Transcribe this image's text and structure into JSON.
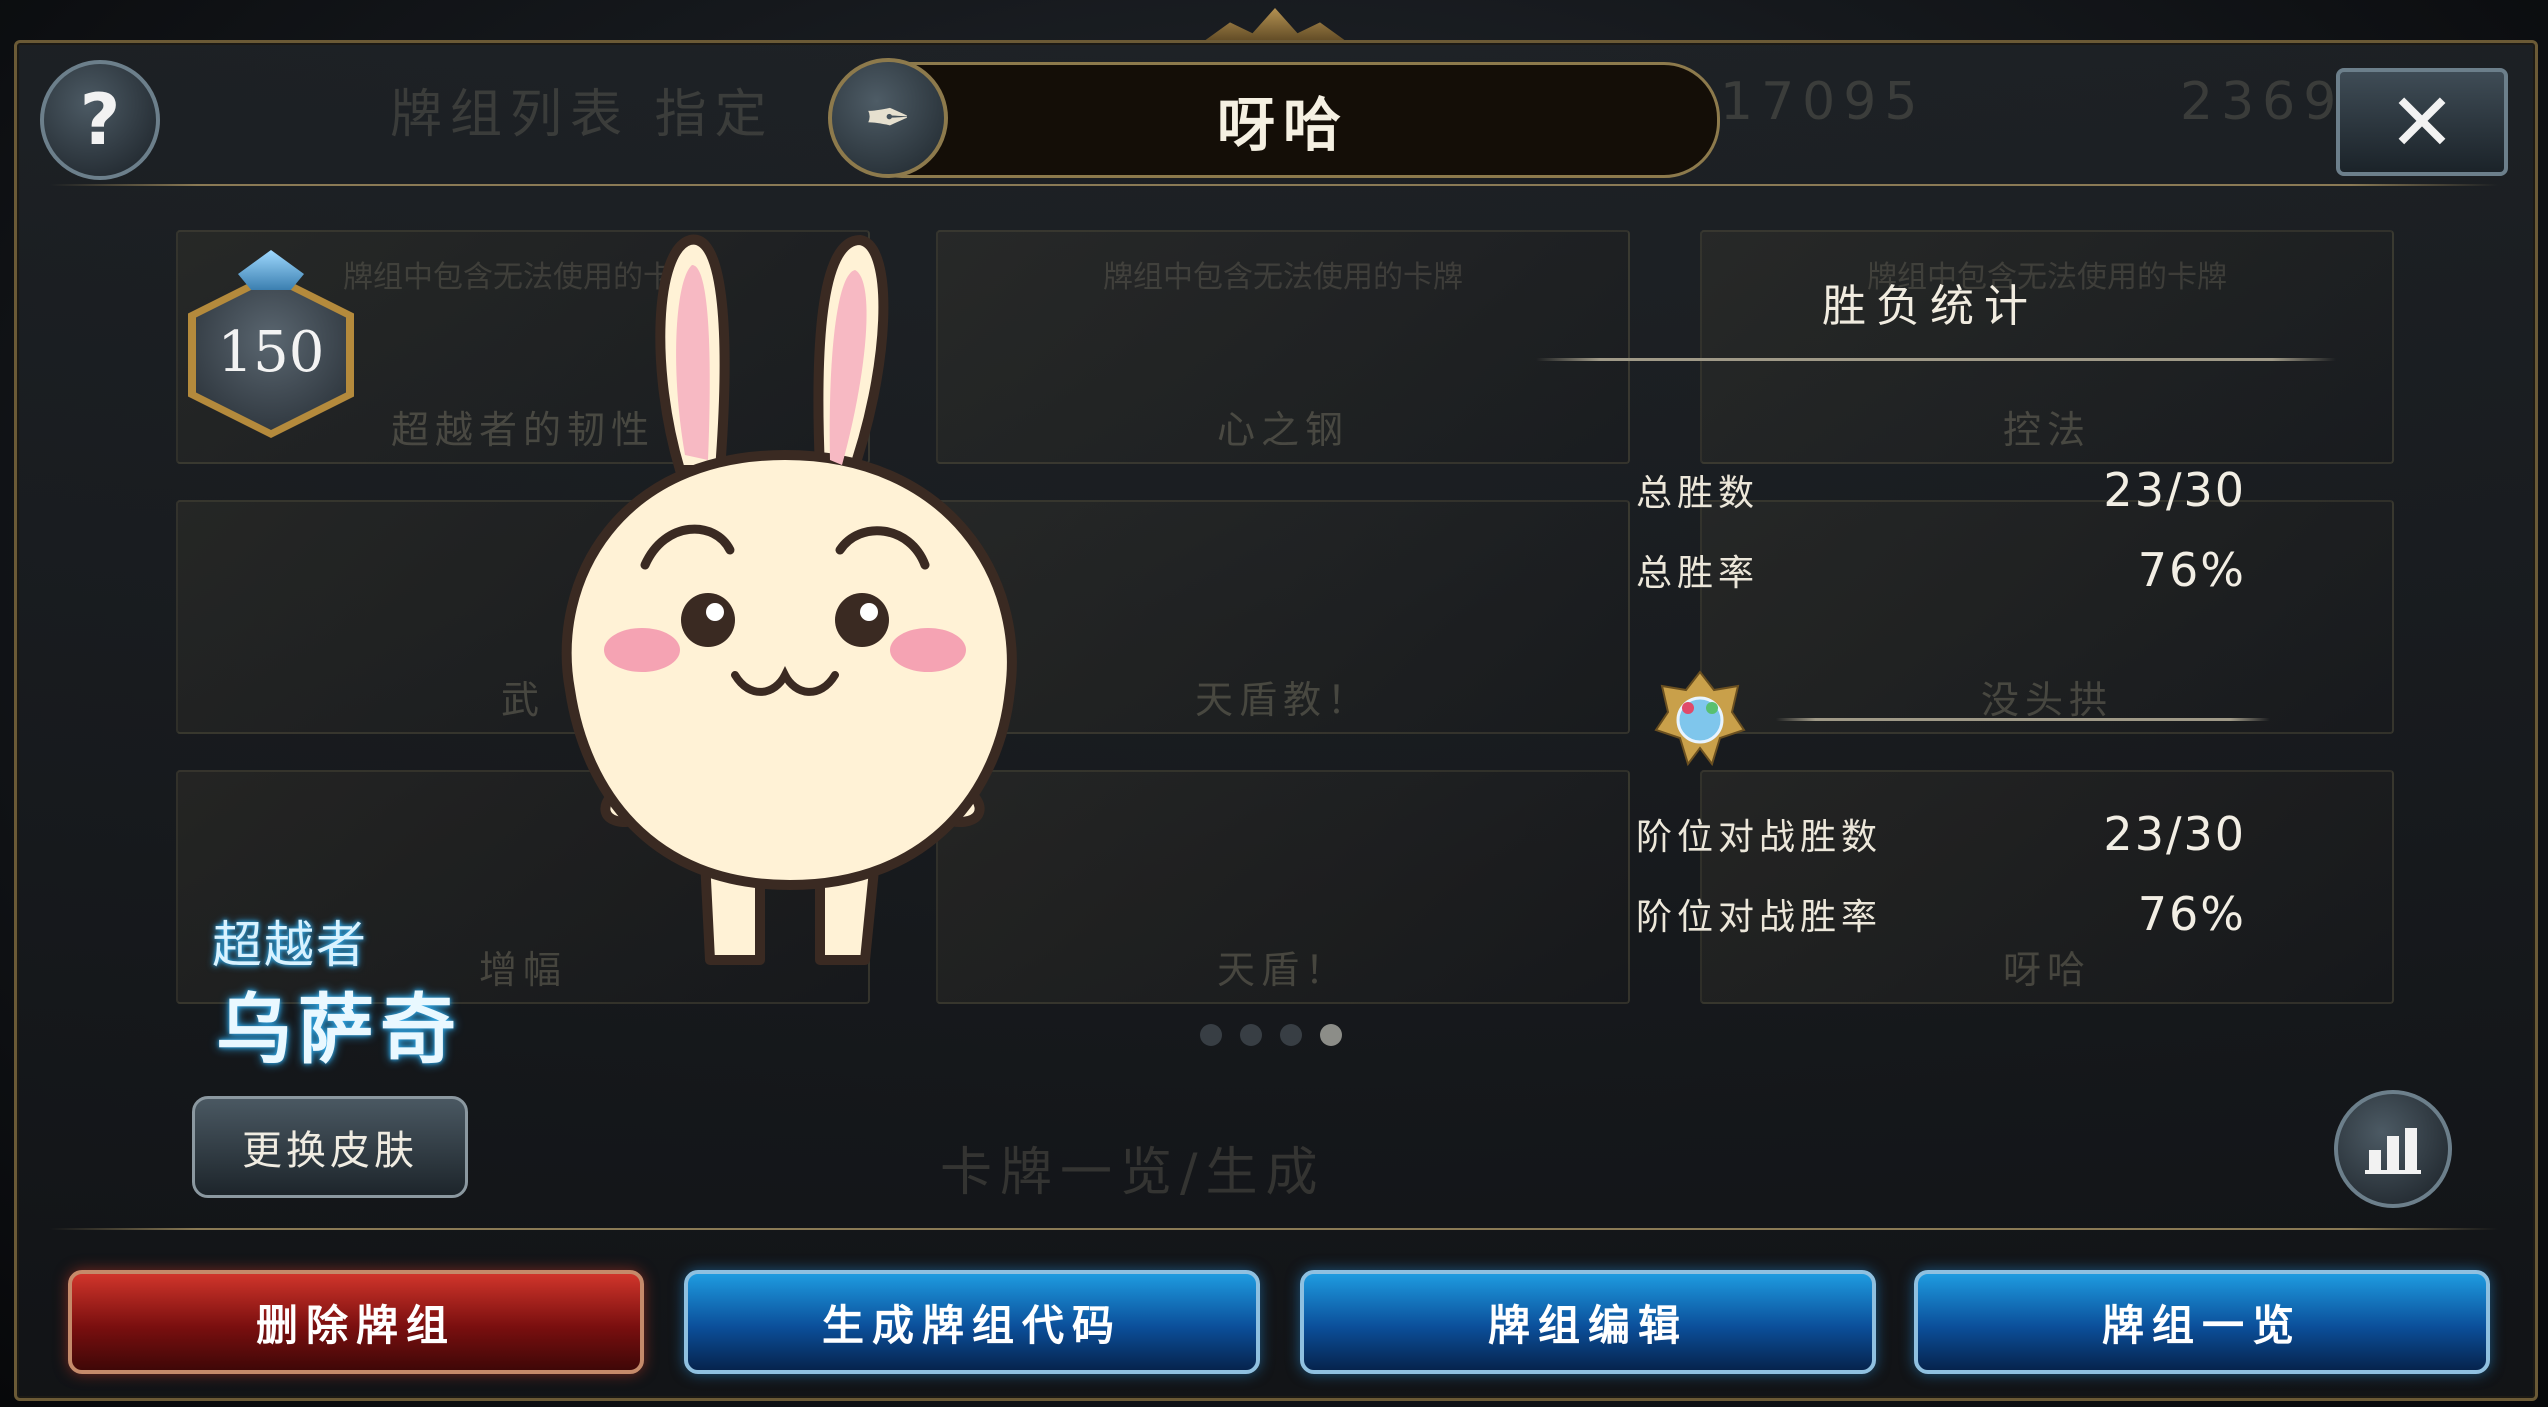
{
  "header": {
    "deck_name": "呀哈",
    "help_label": "?",
    "close_label": "✕",
    "edit_icon": "✒"
  },
  "background": {
    "ghost_texts": [
      "牌组列表 指定",
      "17095",
      "2369",
      "卡牌一览/生成"
    ],
    "tiles": [
      {
        "name": "超越者的韧性",
        "warning": "牌组中包含无法使用的卡牌"
      },
      {
        "name": "心之钢",
        "warning": "牌组中包含无法使用的卡牌"
      },
      {
        "name": "控法",
        "warning": "牌组中包含无法使用的卡牌"
      },
      {
        "name": "武",
        "warning": ""
      },
      {
        "name": "天盾教！",
        "warning": ""
      },
      {
        "name": "没头拱",
        "warning": ""
      },
      {
        "name": "增幅",
        "warning": ""
      },
      {
        "name": "天盾！",
        "warning": ""
      },
      {
        "name": "呀哈",
        "warning": ""
      }
    ]
  },
  "leader": {
    "level": "150",
    "title": "超越者",
    "name": "乌萨奇",
    "skin_button": "更换皮肤"
  },
  "stats": {
    "title": "胜负统计",
    "total_wins_label": "总胜数",
    "total_wins_value": "23/30",
    "total_rate_label": "总胜率",
    "total_rate_value": "76%",
    "ranked_wins_label": "阶位对战胜数",
    "ranked_wins_value": "23/30",
    "ranked_rate_label": "阶位对战胜率",
    "ranked_rate_value": "76%"
  },
  "actions": {
    "delete": "删除牌组",
    "generate_code": "生成牌组代码",
    "edit": "牌组编辑",
    "overview": "牌组一览"
  },
  "colors": {
    "delete_button": "#b0241d",
    "action_button": "#0b6ac0",
    "gold_border": "#8d7a4c",
    "title_glow": "#2fa8e8"
  }
}
